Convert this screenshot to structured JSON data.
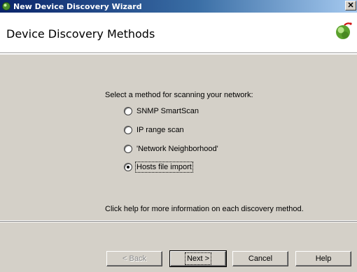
{
  "window": {
    "title": "New Device Discovery Wizard",
    "close_glyph": "×"
  },
  "header": {
    "title": "Device Discovery Methods",
    "logo_icon": "wizard-logo-icon"
  },
  "content": {
    "prompt": "Select a method for scanning your network:",
    "options": [
      {
        "label": "SNMP SmartScan",
        "selected": false
      },
      {
        "label": "IP range scan",
        "selected": false
      },
      {
        "label": "'Network Neighborhood'",
        "selected": false
      },
      {
        "label": "Hosts file import",
        "selected": true
      }
    ],
    "help_text": "Click help for more information on each discovery method."
  },
  "buttons": {
    "back": "< Back",
    "next": "Next >",
    "cancel": "Cancel",
    "help": "Help"
  },
  "colors": {
    "titlebar_start": "#0a246a",
    "titlebar_end": "#a6caf0",
    "dialog_face": "#d4d0c8",
    "logo_green": "#5aa02c",
    "logo_red": "#d01010"
  }
}
